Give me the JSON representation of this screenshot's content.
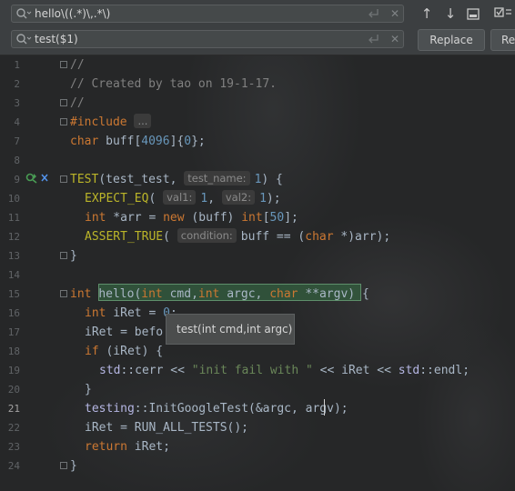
{
  "find": {
    "search_value": "hello\\((.*)\\,.*\\)",
    "replace_value": "test($1)",
    "replace_label": "Replace",
    "replace_all_label": "Re"
  },
  "editor": {
    "line_numbers": [
      "1",
      "2",
      "3",
      "4",
      "7",
      "8",
      "9",
      "10",
      "11",
      "12",
      "13",
      "14",
      "15",
      "16",
      "17",
      "18",
      "19",
      "20",
      "21",
      "22",
      "23",
      "24"
    ],
    "current_line": "21",
    "lines": {
      "l1": "//",
      "l2": "// Created by tao on 19-1-17.",
      "l3": "//",
      "l4_include": "#include",
      "l4_fold": "...",
      "l7_type": "char",
      "l7_name": " buff[",
      "l7_size": "4096",
      "l7_end": "]{",
      "l7_zero": "0",
      "l7_close": "};",
      "l9_macro": "TEST",
      "l9_open": "(test_test, ",
      "l9_hint": "test_name:",
      "l9_num": "1",
      "l9_close": ") {",
      "l10_macro": "EXPECT_EQ",
      "l10_open": "( ",
      "l10_hint1": "val1:",
      "l10_num1": "1",
      "l10_comma": ", ",
      "l10_hint2": "val2:",
      "l10_num2": "1",
      "l10_close": ");",
      "l11_type": "int",
      "l11_mid": " *arr = ",
      "l11_new": "new",
      "l11_buff": " (buff) ",
      "l11_int": "int",
      "l11_bracket": "[",
      "l11_num": "50",
      "l11_end": "];",
      "l12_macro": "ASSERT_TRUE",
      "l12_open": "( ",
      "l12_hint": "condition:",
      "l12_expr": "buff == (",
      "l12_char": "char",
      "l12_end": " *)arr);",
      "l13": "}",
      "l15_type": "int",
      "l15_sp": " ",
      "l15_fn": "hello",
      "l15_open": "(",
      "l15_int1": "int",
      "l15_cmd": " cmd,",
      "l15_int2": "int",
      "l15_argc": " argc, ",
      "l15_char": "char",
      "l15_argv": " **argv) {",
      "l16_int": "int",
      "l16_rest": " iRet = ",
      "l16_num": "0",
      "l16_end": ";",
      "l17": "iRet = befo",
      "l18_if": "if",
      "l18_rest": " (iRet) {",
      "l19_ns": "std",
      "l19_a": "::cerr << ",
      "l19_str": "\"init fail with \"",
      "l19_b": " << iRet << ",
      "l19_ns2": "std",
      "l19_c": "::endl;",
      "l20": "}",
      "l21_ns": "testing",
      "l21_rest": "::InitGoogleTest(&argc, argv);",
      "l22": "iRet = RUN_ALL_TESTS();",
      "l23_ret": "return",
      "l23_rest": " iRet;",
      "l24": "}"
    },
    "tooltip": "test(int cmd,int argc)"
  },
  "colors": {
    "background": "#262728",
    "keyword": "#cc7832",
    "comment": "#808080",
    "number": "#6897bb",
    "string": "#6a8759",
    "macro": "#bbb529",
    "match_highlight": "#32593d"
  },
  "icons": [
    "search-icon",
    "clear-icon",
    "newline-icon",
    "arrow-up-icon",
    "arrow-down-icon",
    "select-all-icon",
    "filter-icon",
    "run-test-icon",
    "test-status-icon"
  ]
}
